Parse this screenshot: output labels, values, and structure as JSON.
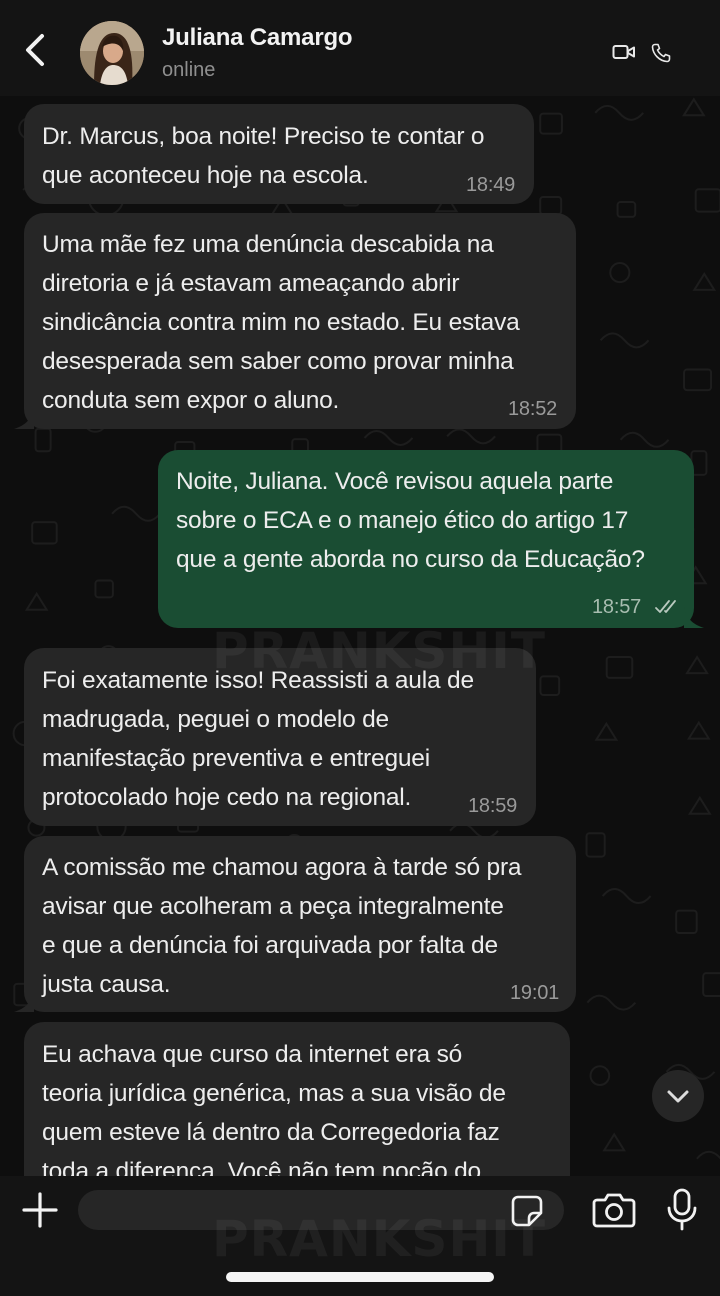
{
  "contact": {
    "name": "Juliana Camargo",
    "status": "online"
  },
  "messages": [
    {
      "direction": "in",
      "lines": [
        "Dr. Marcus, boa noite! Preciso te contar o",
        "que aconteceu hoje na escola."
      ],
      "time": "18:49"
    },
    {
      "direction": "in",
      "lines": [
        "Uma mãe fez uma denúncia descabida na",
        "diretoria e já estavam ameaçando abrir",
        "sindicância contra mim no estado. Eu estava",
        "desesperada sem saber como provar minha",
        "conduta sem expor o aluno."
      ],
      "time": "18:52"
    },
    {
      "direction": "out",
      "lines": [
        "Noite, Juliana. Você revisou aquela parte",
        "sobre o ECA e o manejo ético do artigo 17",
        "que a gente aborda no curso da Educação?"
      ],
      "time": "18:57",
      "read": true
    },
    {
      "direction": "in",
      "lines": [
        "Foi exatamente isso! Reassisti a aula de",
        "madrugada, peguei o modelo de",
        "manifestação preventiva e entreguei",
        "protocolado hoje cedo na regional."
      ],
      "time": "18:59"
    },
    {
      "direction": "in",
      "lines": [
        "A comissão me chamou agora à tarde só pra",
        "avisar que acolheram a peça integralmente",
        "e que a denúncia foi arquivada por falta de",
        "justa causa."
      ],
      "time": "19:01"
    },
    {
      "direction": "in",
      "lines": [
        "Eu achava que curso da internet era só",
        "teoria jurídica genérica, mas a sua visão de",
        "quem esteve lá dentro da Corregedoria faz",
        "toda a diferença. Você não tem noção do"
      ],
      "time": ""
    }
  ],
  "composer": {
    "value": "",
    "placeholder": ""
  },
  "watermark": "PRANKSHIT",
  "icons": {
    "back": "chevron-left-icon",
    "video": "video-camera-icon",
    "phone": "phone-icon",
    "scroll": "chevron-down-icon",
    "add": "plus-icon",
    "sticker": "sticker-icon",
    "camera": "camera-icon",
    "mic": "microphone-icon"
  },
  "colors": {
    "incoming_bubble": "#262626",
    "outgoing_bubble": "#1a4d33",
    "header": "#141414",
    "background": "#0e0e0e"
  }
}
